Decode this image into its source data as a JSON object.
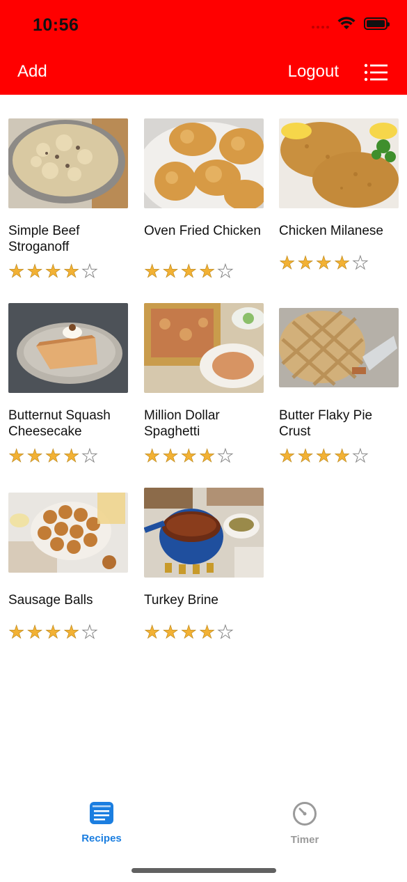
{
  "status_bar": {
    "time": "10:56"
  },
  "nav": {
    "add_label": "Add",
    "logout_label": "Logout",
    "menu_icon": "list-icon"
  },
  "recipes": [
    {
      "title": "Simple Beef Stroganoff",
      "rating": 4,
      "max_rating": 5,
      "image": "beef-stroganoff-photo"
    },
    {
      "title": "Oven Fried Chicken",
      "rating": 4,
      "max_rating": 5,
      "image": "fried-chicken-photo"
    },
    {
      "title": "Chicken Milanese",
      "rating": 4,
      "max_rating": 5,
      "image": "chicken-milanese-photo"
    },
    {
      "title": "Butternut Squash Cheesecake",
      "rating": 4,
      "max_rating": 5,
      "image": "cheesecake-photo"
    },
    {
      "title": "Million Dollar Spaghetti",
      "rating": 4,
      "max_rating": 5,
      "image": "spaghetti-photo"
    },
    {
      "title": "Butter Flaky Pie Crust",
      "rating": 4,
      "max_rating": 5,
      "image": "pie-crust-photo"
    },
    {
      "title": "Sausage Balls",
      "rating": 4,
      "max_rating": 5,
      "image": "sausage-balls-photo"
    },
    {
      "title": "Turkey Brine",
      "rating": 4,
      "max_rating": 5,
      "image": "turkey-brine-photo"
    }
  ],
  "tabs": [
    {
      "label": "Recipes",
      "icon": "recipes-icon",
      "active": true
    },
    {
      "label": "Timer",
      "icon": "timer-icon",
      "active": false
    }
  ],
  "colors": {
    "header": "#ff0000",
    "accent": "#1b7ee0",
    "star": "#f2b134",
    "inactive_tab": "#9a9a9a"
  }
}
